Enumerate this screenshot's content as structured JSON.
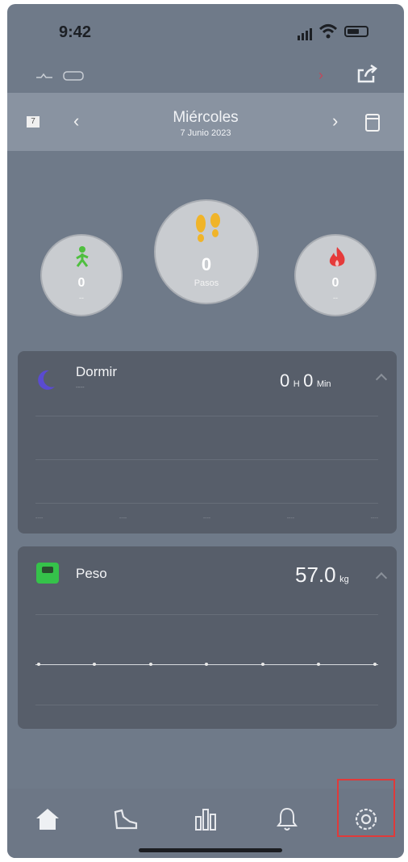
{
  "status_bar": {
    "time": "9:42"
  },
  "date_nav": {
    "weekday": "Miércoles",
    "date": "7 Junio 2023",
    "left_badge": "7",
    "prev": "‹",
    "next": "›"
  },
  "circles": {
    "left": {
      "value": "0",
      "label": "--"
    },
    "center": {
      "value": "0",
      "label": "Pasos"
    },
    "right": {
      "value": "0",
      "label": "--"
    }
  },
  "sleep_card": {
    "title": "Dormir",
    "subtitle": "----",
    "hours": "0",
    "hours_unit": "H",
    "minutes": "0",
    "minutes_unit": "Min",
    "ticks": [
      "----",
      "----",
      "----",
      "----",
      "----"
    ]
  },
  "weight_card": {
    "title": "Peso",
    "value": "57.0",
    "unit": "kg"
  },
  "tabs": [
    "home-icon",
    "shoe-icon",
    "bar-chart-icon",
    "bell-icon",
    "settings-icon"
  ],
  "colors": {
    "screen_bg": "#6f7a89",
    "card_bg": "#575e6a",
    "highlight": "#e03a3a",
    "steps_green": "#4fbf3f",
    "steps_yellow": "#f0b429",
    "fire_red": "#e53b3b",
    "weight_green": "#35c24a"
  }
}
